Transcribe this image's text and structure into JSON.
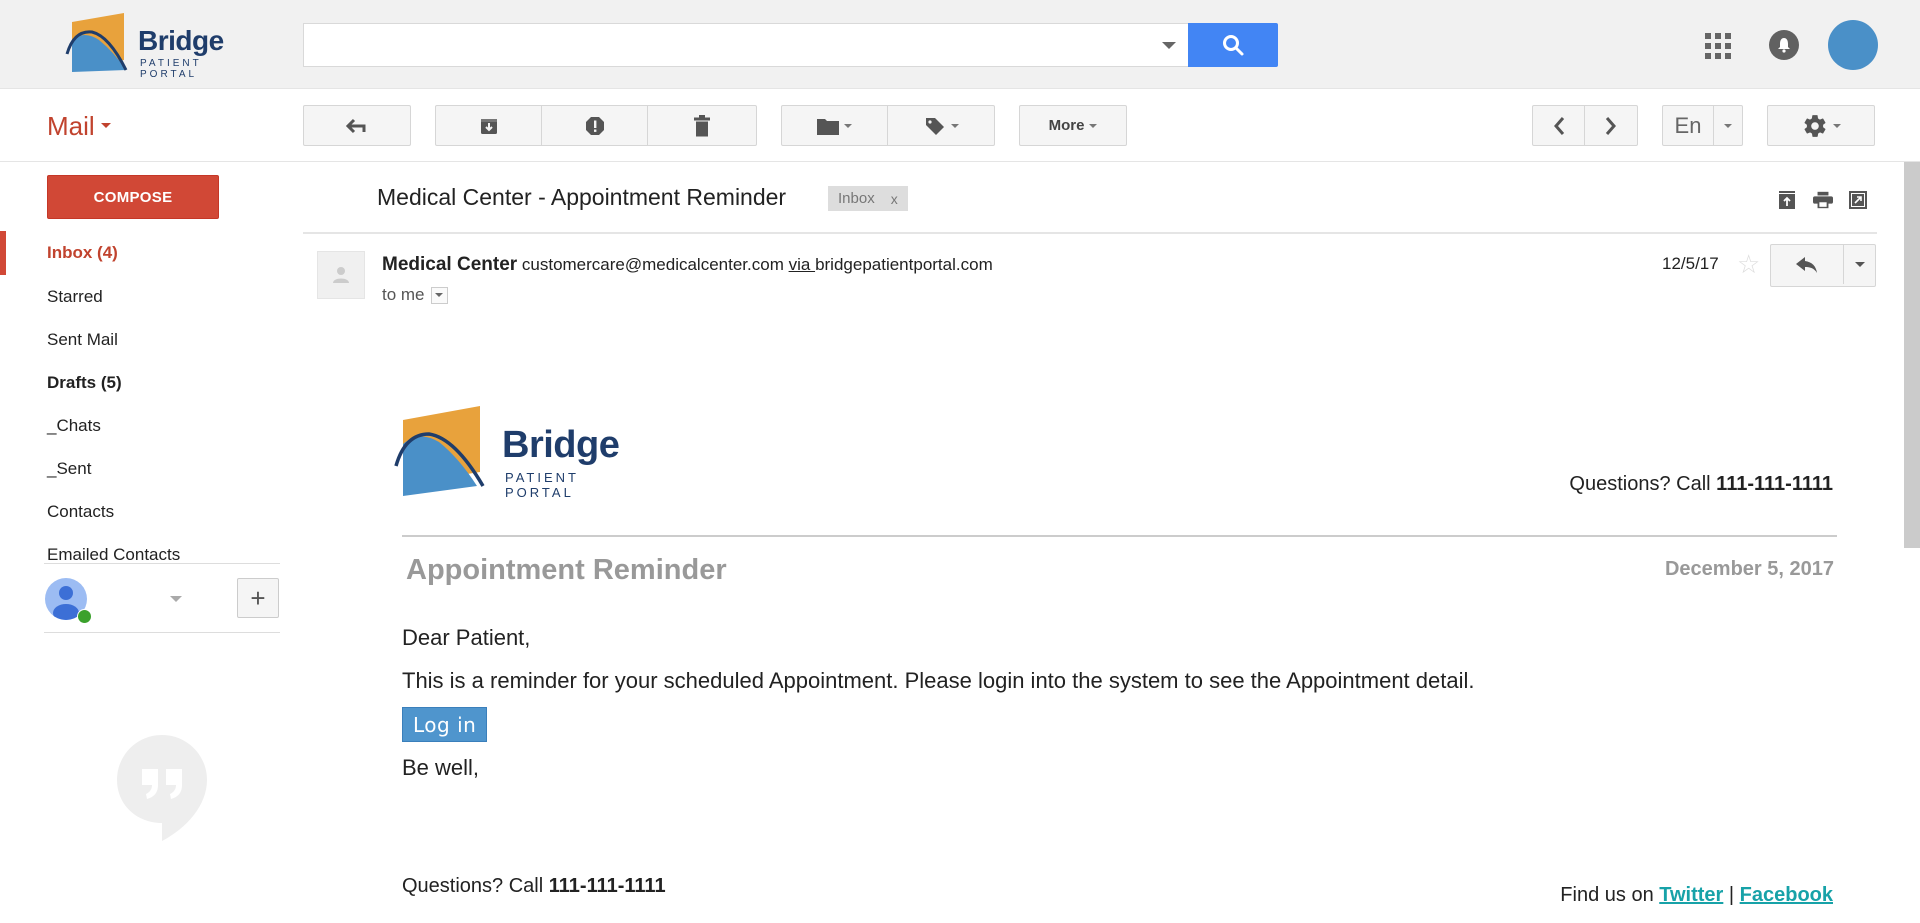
{
  "header": {
    "logo": {
      "brand": "Bridge",
      "tagline": "PATIENT PORTAL"
    },
    "search": {
      "value": "",
      "placeholder": ""
    },
    "icons": [
      "apps-grid-icon",
      "notifications-bell-icon",
      "account-avatar"
    ]
  },
  "toolbar": {
    "app_label": "Mail",
    "more_label": "More",
    "language_label": "En",
    "buttons": [
      "back-to-inbox",
      "archive",
      "report-spam",
      "delete",
      "move-to",
      "labels",
      "more",
      "newer",
      "older",
      "input-tools",
      "settings"
    ]
  },
  "sidebar": {
    "compose_label": "COMPOSE",
    "items": [
      {
        "label": "Inbox (4)",
        "active": true
      },
      {
        "label": "Starred"
      },
      {
        "label": "Sent Mail"
      },
      {
        "label": "Drafts (5)",
        "bold": true
      },
      {
        "label": "_Chats"
      },
      {
        "label": "_Sent"
      },
      {
        "label": "Contacts"
      },
      {
        "label": "Emailed Contacts"
      }
    ],
    "chat": {
      "username": "",
      "add_label": "+"
    }
  },
  "email": {
    "subject": "Medical Center - Appointment Reminder",
    "label_chip": "Inbox",
    "label_chip_close": "x",
    "sender_name": "Medical Center",
    "sender_email": "customercare@medicalcenter.com",
    "via_label": "via ",
    "via_domain": "bridgepatientportal.com",
    "to_label": "to me",
    "date": "12/5/17",
    "body": {
      "logo": {
        "brand": "Bridge",
        "tagline": "PATIENT PORTAL"
      },
      "questions_prefix": "Questions? Call ",
      "phone": "111-111-1111",
      "title": "Appointment Reminder",
      "date": "December 5, 2017",
      "greeting": "Dear Patient,",
      "message": "This is a reminder for your scheduled Appointment. Please login into the system to see the Appointment detail.",
      "login_label": "Log in",
      "signoff": "Be well,",
      "findus_prefix": "Find us on ",
      "twitter_label": "Twitter",
      "separator": " | ",
      "facebook_label": "Facebook"
    }
  },
  "colors": {
    "accent_red": "#d14836",
    "search_blue": "#4285f4",
    "login_blue": "#4f95cd",
    "link_teal": "#17a2a8",
    "logo_navy": "#1f3d6b",
    "logo_orange": "#e8a23c",
    "logo_blue": "#4a90c8"
  }
}
